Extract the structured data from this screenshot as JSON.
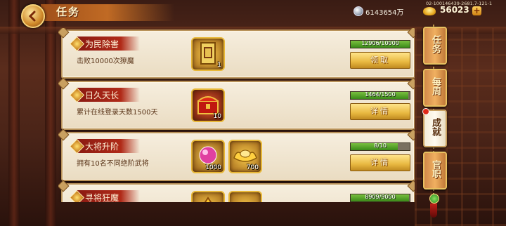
{
  "header": {
    "title": "任务",
    "silver_value": "6143654万",
    "server_id": "02-100146439-2681.7-121-1",
    "gold_value": "56023",
    "plus_label": "+"
  },
  "tabs": [
    {
      "label": "任务",
      "active": false
    },
    {
      "label": "每周",
      "active": false
    },
    {
      "label": "成就",
      "active": true
    },
    {
      "label": "官职",
      "active": false
    }
  ],
  "tasks": [
    {
      "name": "为民除害",
      "desc": "击败10000次獠魔",
      "progress_text": "12906/10000",
      "progress_fraction": 1.0,
      "action": "领取",
      "rewards": [
        {
          "icon": "scroll-book-icon",
          "count": "1"
        }
      ]
    },
    {
      "name": "日久天长",
      "desc": "累计在线登录天数1500天",
      "progress_text": "1464/1500",
      "progress_fraction": 0.976,
      "action": "详情",
      "rewards": [
        {
          "icon": "treasure-chest-icon",
          "count": "10"
        }
      ]
    },
    {
      "name": "大将升阶",
      "desc": "拥有10名不同绝阶武将",
      "progress_text": "8/10",
      "progress_fraction": 0.8,
      "action": "详情",
      "rewards": [
        {
          "icon": "pink-gem-icon",
          "count": "1000"
        },
        {
          "icon": "gold-ingot-icon",
          "count": "700"
        }
      ]
    },
    {
      "name": "寻将狂魔",
      "desc": "",
      "progress_text": "8909/9000",
      "progress_fraction": 0.99,
      "action": "",
      "rewards": [
        {
          "icon": "gold-ornament-icon",
          "count": ""
        },
        {
          "icon": "gold-ingot-icon",
          "count": ""
        }
      ]
    }
  ]
}
